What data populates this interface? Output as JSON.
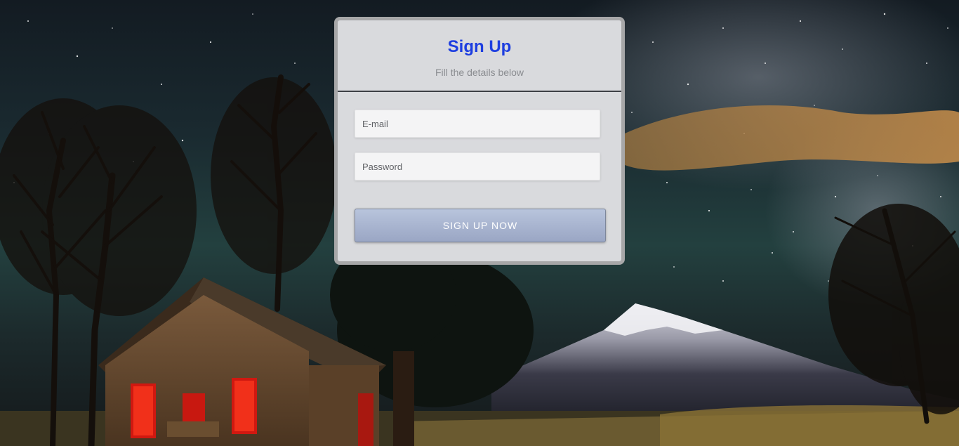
{
  "form": {
    "title": "Sign Up",
    "subtitle": "Fill the details below",
    "email_placeholder": "E-mail",
    "password_placeholder": "Password",
    "submit_label": "SIGN UP NOW"
  },
  "colors": {
    "title": "#1d3ee0",
    "card_background": "#d9dadd",
    "button_gradient_top": "#b8c4dc",
    "button_gradient_bottom": "#9aa6c4"
  }
}
